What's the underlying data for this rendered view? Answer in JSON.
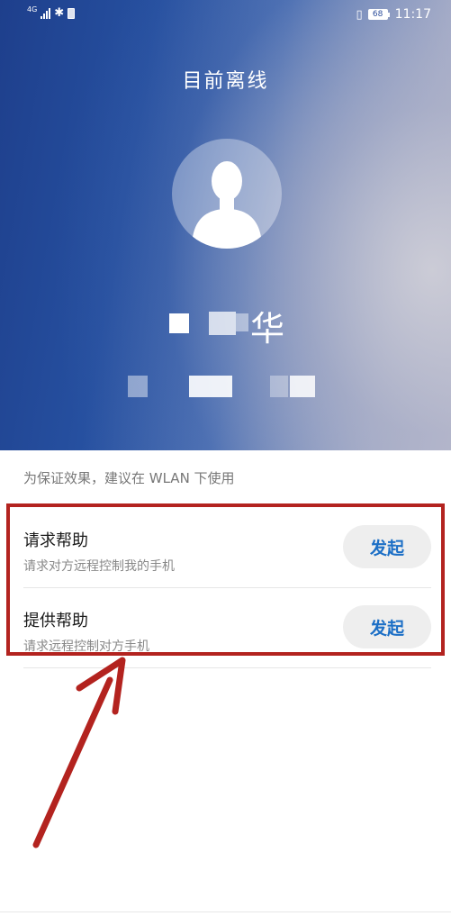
{
  "status_bar": {
    "network": "4G",
    "battery": "68",
    "time": "11:17"
  },
  "header": {
    "title": "目前离线"
  },
  "profile": {
    "name_visible_char": "华"
  },
  "notice": "为保证效果，建议在 WLAN 下使用",
  "options": [
    {
      "title": "请求帮助",
      "description": "请求对方远程控制我的手机",
      "button": "发起"
    },
    {
      "title": "提供帮助",
      "description": "请求远程控制对方手机",
      "button": "发起"
    }
  ],
  "colors": {
    "accent": "#1c6fc6",
    "annotation": "#b3231f",
    "hero_start": "#1e3f8c",
    "hero_end": "#c6c3cf"
  },
  "icons": [
    "signal-icon",
    "bluetooth-icon",
    "sim-icon",
    "vibrate-icon",
    "battery-icon",
    "avatar-icon"
  ]
}
